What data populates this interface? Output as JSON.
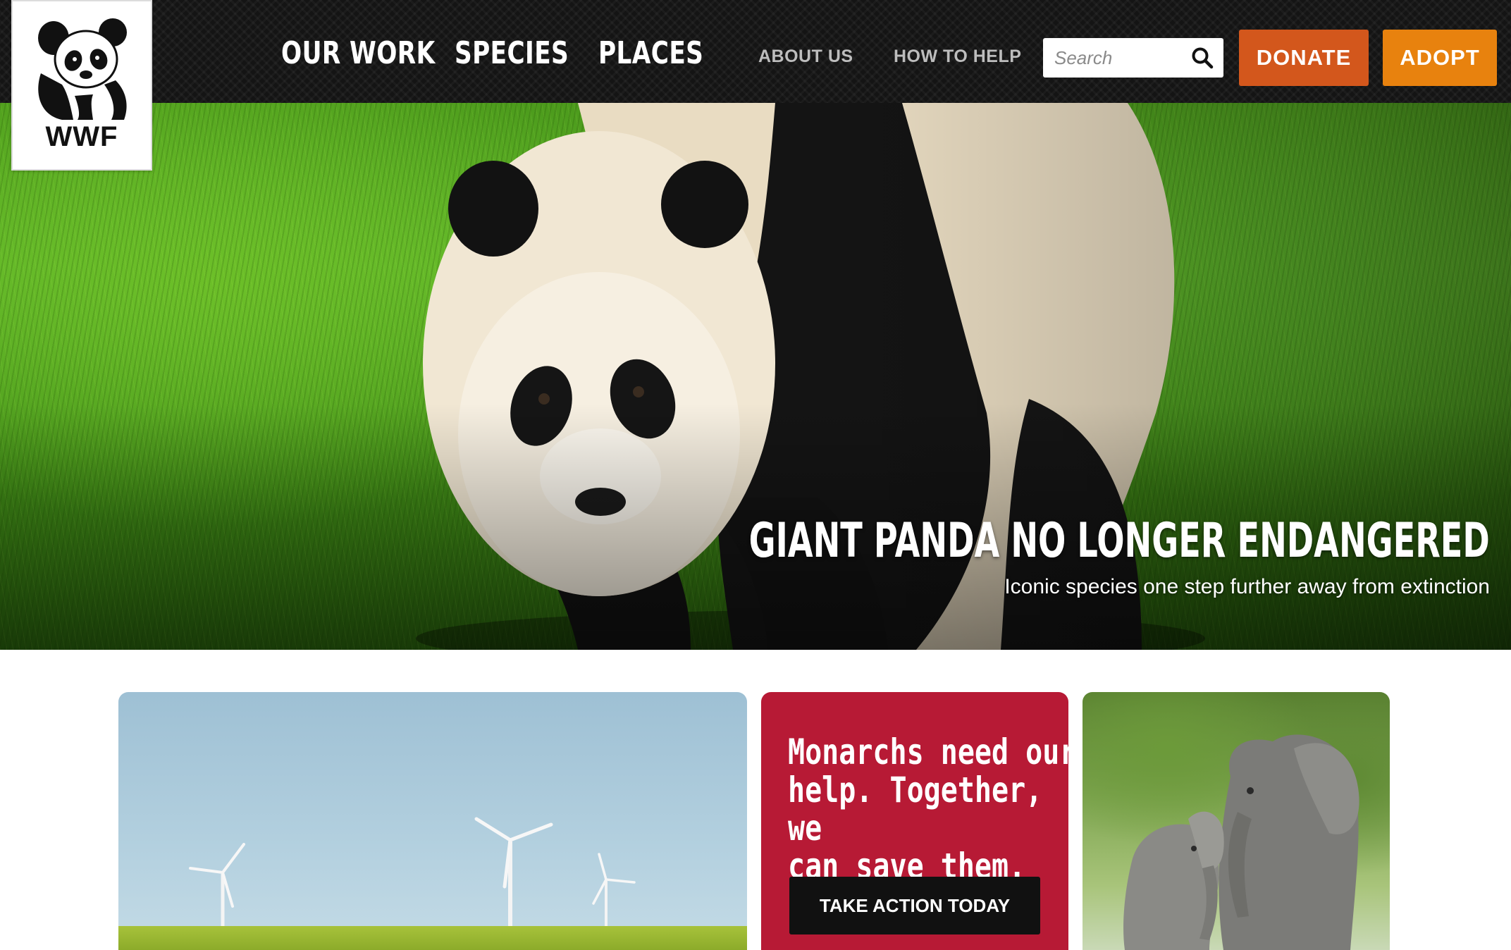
{
  "brand": {
    "logo_text": "WWF"
  },
  "nav": {
    "primary": [
      {
        "label": "OUR WORK"
      },
      {
        "label": "SPECIES"
      },
      {
        "label": "PLACES"
      }
    ],
    "secondary": [
      {
        "label": "ABOUT US"
      },
      {
        "label": "HOW TO HELP"
      }
    ]
  },
  "search": {
    "placeholder": "Search",
    "value": ""
  },
  "actions": {
    "donate_label": "DONATE",
    "adopt_label": "ADOPT"
  },
  "hero": {
    "title": "GIANT PANDA NO LONGER ENDANGERED",
    "subtitle": "Iconic species one step further away from extinction"
  },
  "cards": {
    "monarch": {
      "headline_lines": [
        "Monarchs need our",
        "help. Together, we",
        "can save them."
      ],
      "button_label": "TAKE ACTION TODAY"
    }
  },
  "colors": {
    "header_bg": "#141414",
    "donate": "#d3571c",
    "adopt": "#e8820e",
    "monarch_card": "#b71a35"
  }
}
